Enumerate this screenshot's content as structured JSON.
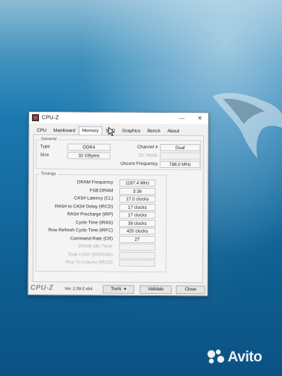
{
  "window": {
    "title": "CPU-Z",
    "minimize_glyph": "—",
    "close_glyph": "✕"
  },
  "tabs": [
    "CPU",
    "Mainboard",
    "Memory",
    "SPD",
    "Graphics",
    "Bench",
    "About"
  ],
  "active_tab": "Memory",
  "general": {
    "label": "General",
    "type_label": "Type",
    "type_value": "DDR4",
    "size_label": "Size",
    "size_value": "32 GBytes",
    "channel_label": "Channel #",
    "channel_value": "Dual",
    "dc_mode_label": "DC Mode",
    "dc_mode_value": "",
    "uncore_label": "Uncore Frequency",
    "uncore_value": "798.0 MHz"
  },
  "timings": {
    "label": "Timings",
    "rows": [
      {
        "label": "DRAM Frequency",
        "value": "1197.4 MHz"
      },
      {
        "label": "FSB:DRAM",
        "value": "3:36"
      },
      {
        "label": "CAS# Latency (CL)",
        "value": "17.0 clocks"
      },
      {
        "label": "RAS# to CAS# Delay (tRCD)",
        "value": "17 clocks"
      },
      {
        "label": "RAS# Precharge (tRP)",
        "value": "17 clocks"
      },
      {
        "label": "Cycle Time (tRAS)",
        "value": "39 clocks"
      },
      {
        "label": "Row Refresh Cycle Time (tRFC)",
        "value": "420 clocks"
      },
      {
        "label": "Command Rate (CR)",
        "value": "2T"
      },
      {
        "label": "DRAM Idle Timer",
        "value": ""
      },
      {
        "label": "Total CAS# (tRDRAM)",
        "value": ""
      },
      {
        "label": "Row To Column (tRCD)",
        "value": ""
      }
    ]
  },
  "footer": {
    "logo": "CPU-Z",
    "version": "Ver. 2.09.0.x64",
    "tools_label": "Tools",
    "validate_label": "Validate",
    "close_label": "Close"
  },
  "watermark": {
    "text": "Avito"
  }
}
